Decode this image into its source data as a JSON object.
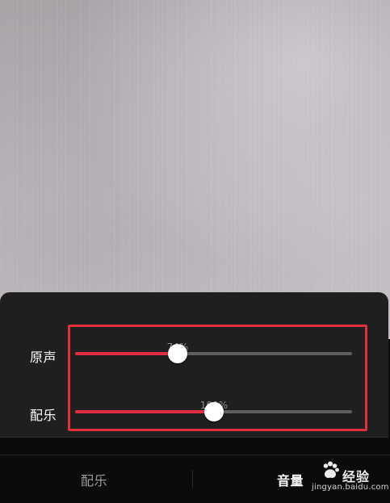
{
  "panel": {
    "sliders": [
      {
        "label": "原声",
        "value_text": "74%",
        "value": 74
      },
      {
        "label": "配乐",
        "value_text": "100%",
        "value": 100
      }
    ]
  },
  "bottom_tabs": {
    "left": "配乐",
    "right": "音量"
  },
  "watermark": {
    "title": "经验",
    "url": "jingyan.baidu.com"
  },
  "colors": {
    "accent": "#e52c45",
    "highlight_box": "#e22f3f",
    "panel_bg": "#1f1f1f",
    "track": "#5f5f5f",
    "thumb": "#ffffff",
    "bottom_bar_bg": "#0b0b0b"
  },
  "icons": {
    "watermark_logo": "paw-icon"
  }
}
